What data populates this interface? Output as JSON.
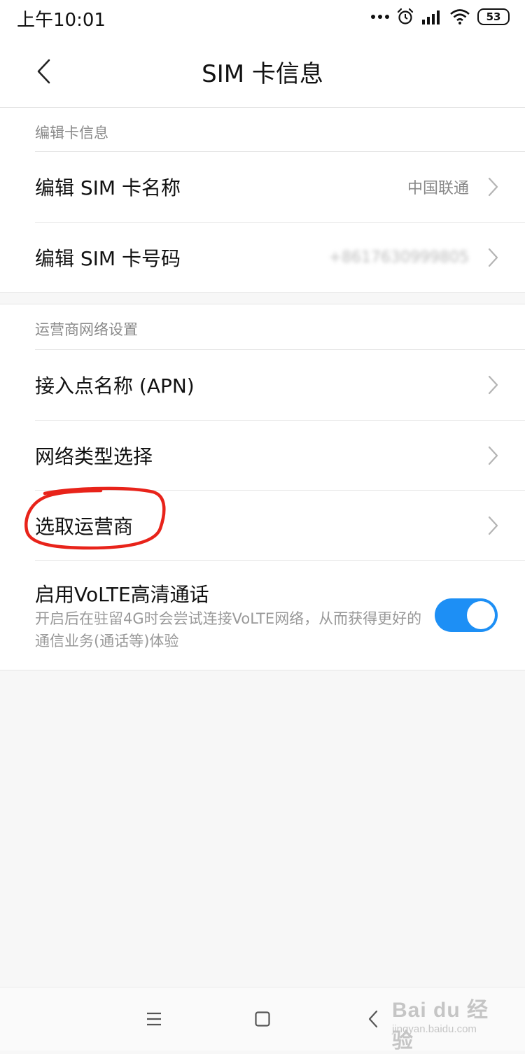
{
  "status_bar": {
    "time": "上午10:01",
    "battery_level": "53",
    "icons": [
      "more-dots-icon",
      "alarm-icon",
      "signal-icon",
      "wifi-icon",
      "battery-icon"
    ]
  },
  "header": {
    "title": "SIM  卡信息",
    "back_icon": "back-chevron-icon"
  },
  "sections": {
    "edit_card": {
      "label": "编辑卡信息",
      "items": [
        {
          "label": "编辑 SIM 卡名称",
          "value": "中国联通"
        },
        {
          "label": "编辑 SIM 卡号码",
          "value": "+8617630999805"
        }
      ]
    },
    "carrier_network": {
      "label": "运营商网络设置",
      "items": [
        {
          "label": "接入点名称 (APN)"
        },
        {
          "label": "网络类型选择"
        },
        {
          "label": "选取运营商"
        }
      ],
      "volte": {
        "title": "启用VoLTE高清通话",
        "description": "开启后在驻留4G时会尝试连接VoLTE网络，从而获得更好的通信业务(通话等)体验",
        "enabled": true
      }
    }
  },
  "nav_bar": {
    "icons": [
      "menu-icon",
      "home-icon",
      "back-icon"
    ]
  },
  "watermark": {
    "text": "Bai du 经验",
    "subtext": "jingyan.baidu.com"
  },
  "colors": {
    "accent": "#1d8ff5",
    "annotation": "#e8231a"
  }
}
